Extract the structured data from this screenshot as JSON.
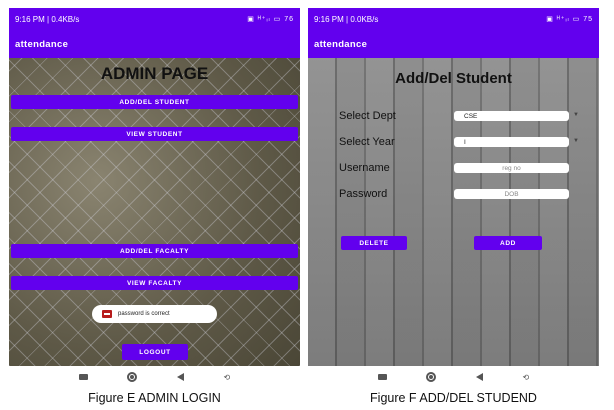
{
  "left_screen": {
    "status": {
      "time": "9:16 PM | 0.4KB/s",
      "icons": "▣ ᴴ⁺ᵢₗ ▭ 76"
    },
    "appbar_title": "attendance",
    "page_title": "ADMIN PAGE",
    "buttons": {
      "add_del_student": "ADD/DEL STUDENT",
      "view_student": "VIEW STUDENT",
      "add_del_faculty": "ADD/DEL FACALTY",
      "view_faculty": "VIEW FACALTY",
      "logout": "LOGOUT"
    },
    "toast": "password is correct"
  },
  "right_screen": {
    "status": {
      "time": "9:16 PM | 0.0KB/s",
      "icons": "▣ ᴴ⁺ᵢₗ ▭ 75"
    },
    "appbar_title": "attendance",
    "page_title": "Add/Del Student",
    "form": {
      "dept_label": "Select Dept",
      "dept_value": "CSE",
      "year_label": "Select Year",
      "year_value": "I",
      "username_label": "Username",
      "username_placeholder": "reg no",
      "password_label": "Password",
      "password_placeholder": "DOB"
    },
    "buttons": {
      "delete": "DELETE",
      "add": "ADD"
    }
  },
  "nav_icons": [
    "recent-apps-icon",
    "home-icon",
    "back-icon",
    "rotate-icon"
  ],
  "captions": {
    "left": "Figure E ADMIN LOGIN",
    "right": "Figure F ADD/DEL STUDEND"
  },
  "colors": {
    "accent": "#6200ee",
    "toast_bg": "#ffffff"
  }
}
